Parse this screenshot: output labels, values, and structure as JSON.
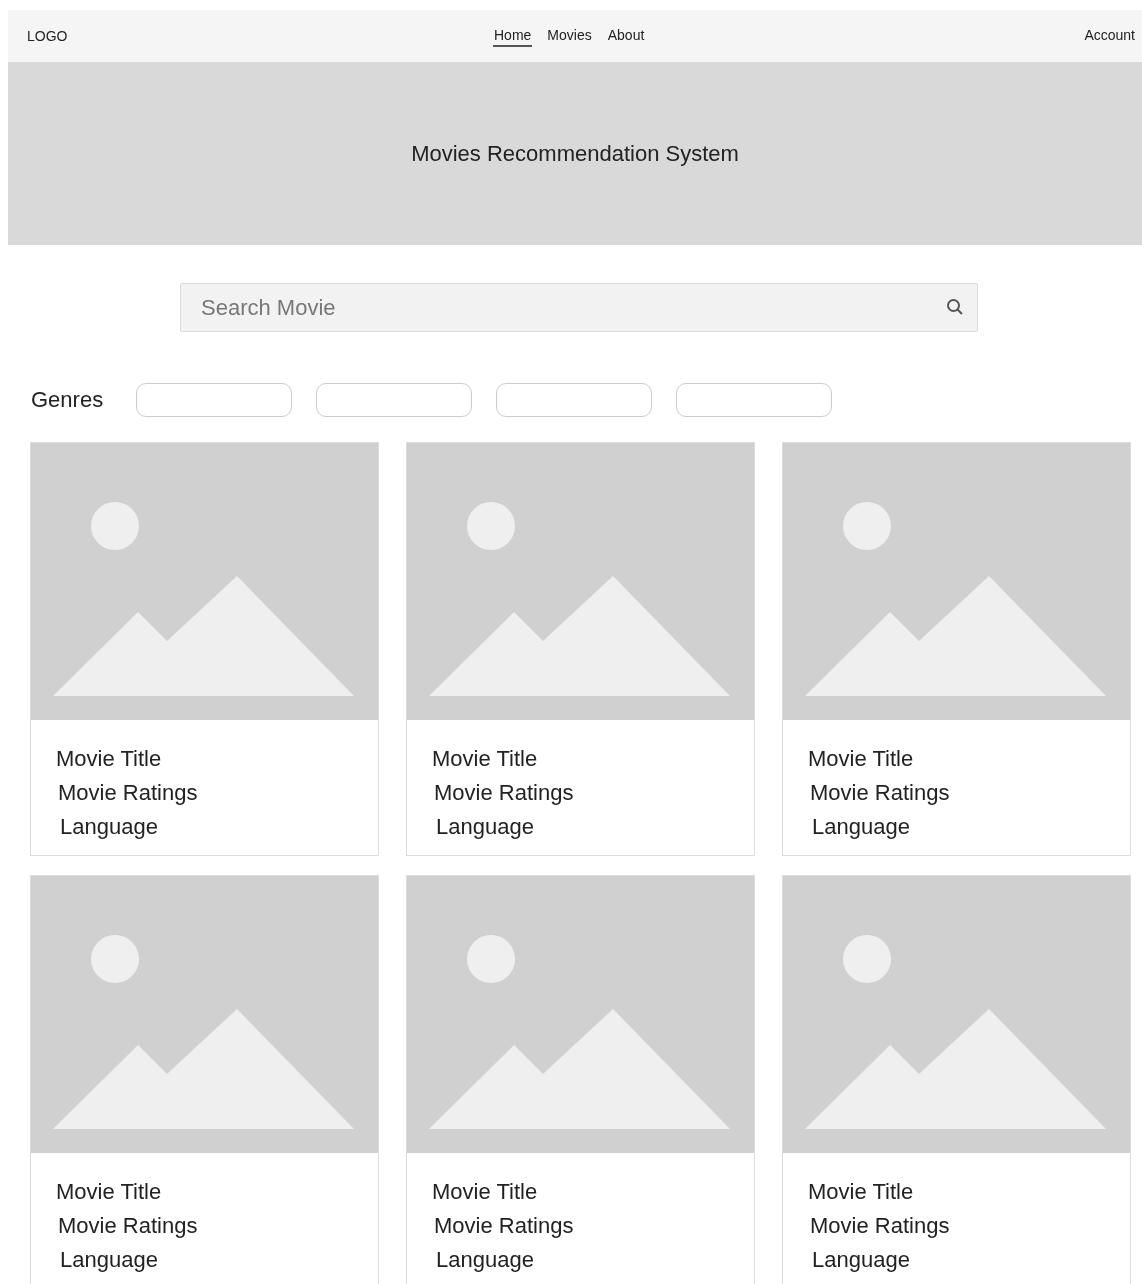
{
  "navbar": {
    "logo": "LOGO",
    "links": [
      {
        "label": "Home",
        "selected": true
      },
      {
        "label": "Movies",
        "selected": false
      },
      {
        "label": "About",
        "selected": false
      }
    ],
    "account": "Account"
  },
  "hero": {
    "title": "Movies Recommendation System"
  },
  "search": {
    "placeholder": "Search Movie"
  },
  "genres": {
    "label": "Genres",
    "chips": [
      {
        "kind": "blank"
      },
      {
        "kind": "blank"
      },
      {
        "kind": "blank"
      },
      {
        "kind": "blank"
      }
    ]
  },
  "movies": [
    {
      "kind": "picture",
      "title": "Movie Title",
      "ratings": "Movie Ratings",
      "language": "Language"
    },
    {
      "kind": "picture",
      "title": "Movie Title",
      "ratings": "Movie Ratings",
      "language": "Language"
    },
    {
      "kind": "picture",
      "title": "Movie Title",
      "ratings": "Movie Ratings",
      "language": "Language"
    },
    {
      "kind": "picture",
      "title": "Movie Title",
      "ratings": "Movie Ratings",
      "language": "Language"
    },
    {
      "kind": "picture",
      "title": "Movie Title",
      "ratings": "Movie Ratings",
      "language": "Language"
    },
    {
      "kind": "picture",
      "title": "Movie Title",
      "ratings": "Movie Ratings",
      "language": "Language"
    }
  ]
}
